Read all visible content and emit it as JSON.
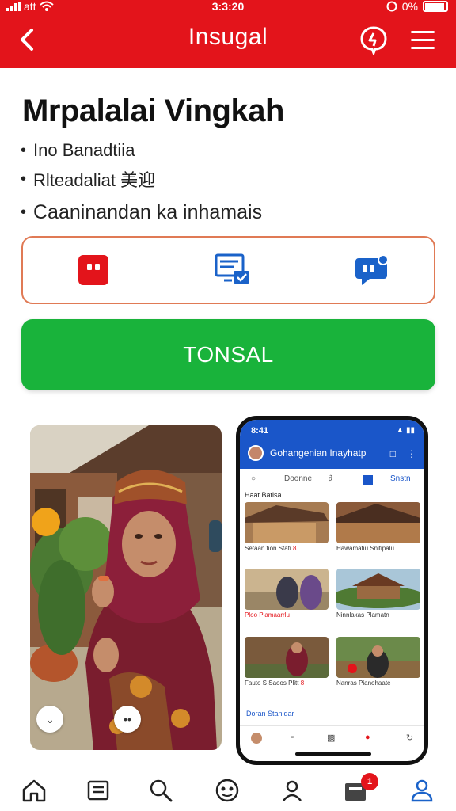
{
  "status_bar": {
    "left_text": "att",
    "time": "3:3:20",
    "battery_text": "0%"
  },
  "header": {
    "title": "Insugal",
    "bg_color": "#e3141b"
  },
  "main": {
    "title": "Mrpalalai Vingkah",
    "bullets": [
      "Ino Banadtiia",
      "Rlteadaliat 美迎",
      "Caaninandan ka inhamais"
    ],
    "cta_label": "TONSAL",
    "cta_color": "#19b33b"
  },
  "icon_row": {
    "icons": [
      "red-square-icon",
      "monitor-message-icon",
      "chat-bubble-icon"
    ]
  },
  "phone": {
    "status_time": "8:41",
    "app_title": "Gohangenian Inayhatp",
    "tabs": [
      "Doonne",
      "Snstn"
    ],
    "section_title": "Haat Batisa",
    "cards": [
      {
        "caption": "Setaan tion Stati",
        "tag": "8"
      },
      {
        "caption": "Hawamatiu Snitipalu",
        "tag": ""
      },
      {
        "caption": "Ploo Plamaarrlu",
        "tag": ""
      },
      {
        "caption": "Ninnlakas Plamatn",
        "tag": ""
      },
      {
        "caption": "Fauto S Saoos Plitt",
        "tag": "8"
      },
      {
        "caption": "Nanras Pianohaate",
        "tag": ""
      }
    ],
    "footer_text": "Doran Stanidar"
  },
  "bottom_nav": {
    "items": [
      "home-icon",
      "list-icon",
      "search-icon",
      "community-icon",
      "profile-icon",
      "inbox-icon",
      "account-icon"
    ],
    "badge": "1"
  }
}
